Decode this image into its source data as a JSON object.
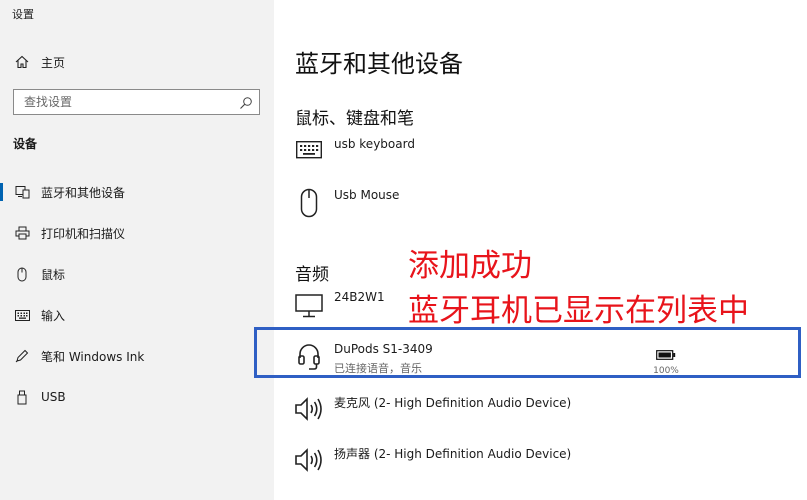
{
  "window": {
    "title": "设置"
  },
  "sidebar": {
    "home_label": "主页",
    "search": {
      "placeholder": "查找设置"
    },
    "section_label": "设备",
    "items": [
      {
        "label": "蓝牙和其他设备",
        "icon": "bluetooth-device-icon",
        "selected": true
      },
      {
        "label": "打印机和扫描仪",
        "icon": "printer-icon"
      },
      {
        "label": "鼠标",
        "icon": "mouse-icon"
      },
      {
        "label": "输入",
        "icon": "keyboard-icon"
      },
      {
        "label": "笔和 Windows Ink",
        "icon": "pen-icon"
      },
      {
        "label": "USB",
        "icon": "usb-icon"
      }
    ]
  },
  "main": {
    "title": "蓝牙和其他设备",
    "groups": [
      {
        "title": "鼠标、键盘和笔",
        "devices": [
          {
            "name": "usb keyboard",
            "icon": "keyboard-icon"
          },
          {
            "name": "Usb Mouse",
            "icon": "mouse-icon"
          }
        ]
      },
      {
        "title": "音频",
        "devices": [
          {
            "name": "24B2W1",
            "icon": "monitor-icon"
          },
          {
            "name": "DuPods S1-3409",
            "status": "已连接语音，音乐",
            "battery": "100%",
            "icon": "headset-icon"
          },
          {
            "name": "麦克风 (2- High Definition Audio Device)",
            "icon": "speaker-icon"
          },
          {
            "name": "扬声器 (2- High Definition Audio Device)",
            "icon": "speaker-icon"
          }
        ]
      }
    ]
  },
  "annotations": {
    "line1": "添加成功",
    "line2": "蓝牙耳机已显示在列表中",
    "color": "#e8141b",
    "box_color": "#2f5fc4"
  },
  "colors": {
    "sidebar_bg": "#f2f2f2",
    "accent": "#0063b1"
  }
}
